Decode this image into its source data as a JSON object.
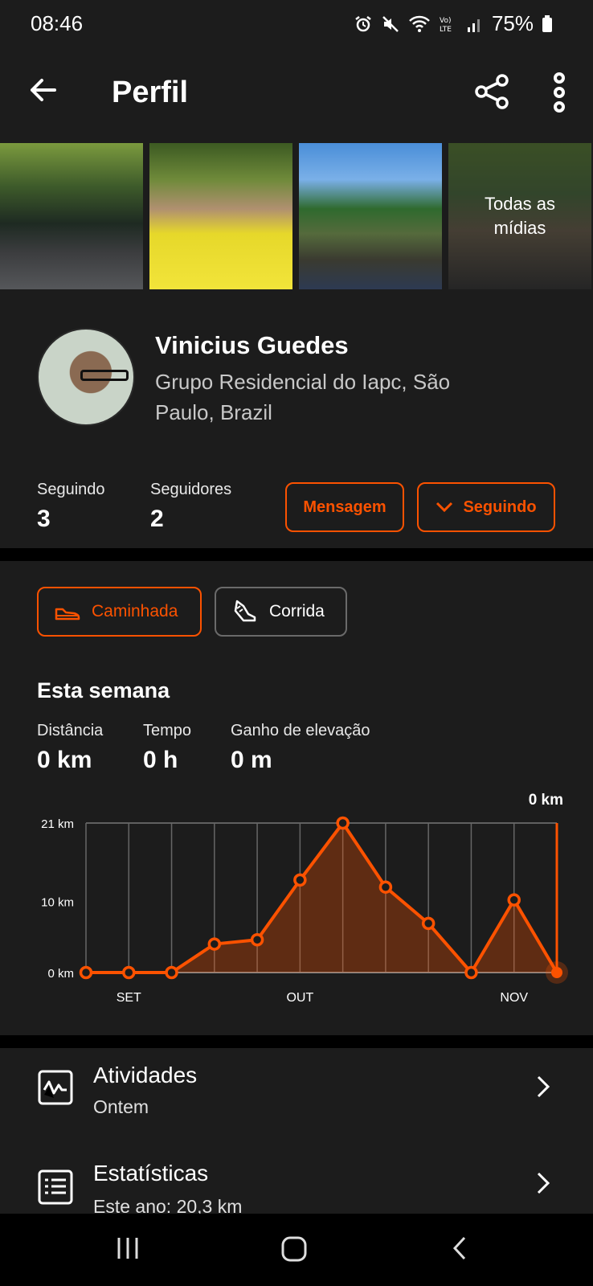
{
  "status_bar": {
    "time": "08:46",
    "battery": "75%",
    "icons": [
      "alarm-icon",
      "mute-icon",
      "wifi-icon",
      "volte-icon",
      "signal-icon",
      "battery-icon"
    ]
  },
  "header": {
    "title": "Perfil",
    "icons": [
      "back-arrow-icon",
      "share-icon",
      "more-vertical-icon"
    ]
  },
  "media": {
    "all_media_label": "Todas as mídias"
  },
  "profile": {
    "name": "Vinicius Guedes",
    "location": "Grupo Residencial do Iapc, São Paulo, Brazil",
    "following_label": "Seguindo",
    "following_count": "3",
    "followers_label": "Seguidores",
    "followers_count": "2",
    "message_button": "Mensagem",
    "following_button": "Seguindo"
  },
  "activity_filters": [
    {
      "label": "Caminhada",
      "icon": "shoe-icon",
      "active": true
    },
    {
      "label": "Corrida",
      "icon": "running-shoe-icon",
      "active": false
    }
  ],
  "week": {
    "title": "Esta semana",
    "distance_label": "Distância",
    "distance_value": "0 km",
    "time_label": "Tempo",
    "time_value": "0 h",
    "elevation_label": "Ganho de elevação",
    "elevation_value": "0 m"
  },
  "chart_data": {
    "type": "area",
    "current_value_label": "0 km",
    "y_ticks": [
      "21 km",
      "10 km",
      "0 km"
    ],
    "ylim": [
      0,
      21
    ],
    "x_tick_labels": [
      {
        "index": 1,
        "label": "SET"
      },
      {
        "index": 5,
        "label": "OUT"
      },
      {
        "index": 10,
        "label": "NOV"
      }
    ],
    "values": [
      0,
      0,
      0,
      4,
      4.6,
      13,
      21,
      12,
      6.9,
      0,
      10.2,
      0
    ],
    "color": "#fc5200"
  },
  "list": [
    {
      "title": "Atividades",
      "subtitle": "Ontem",
      "icon": "activity-chart-icon"
    },
    {
      "title": "Estatísticas",
      "subtitle": "Este ano: 20,3 km",
      "icon": "stats-list-icon"
    }
  ],
  "nav_bar": {
    "icons": [
      "recents-icon",
      "home-icon",
      "back-icon"
    ]
  },
  "colors": {
    "accent": "#fc5200",
    "background": "#1c1c1c",
    "divider": "#000000"
  }
}
